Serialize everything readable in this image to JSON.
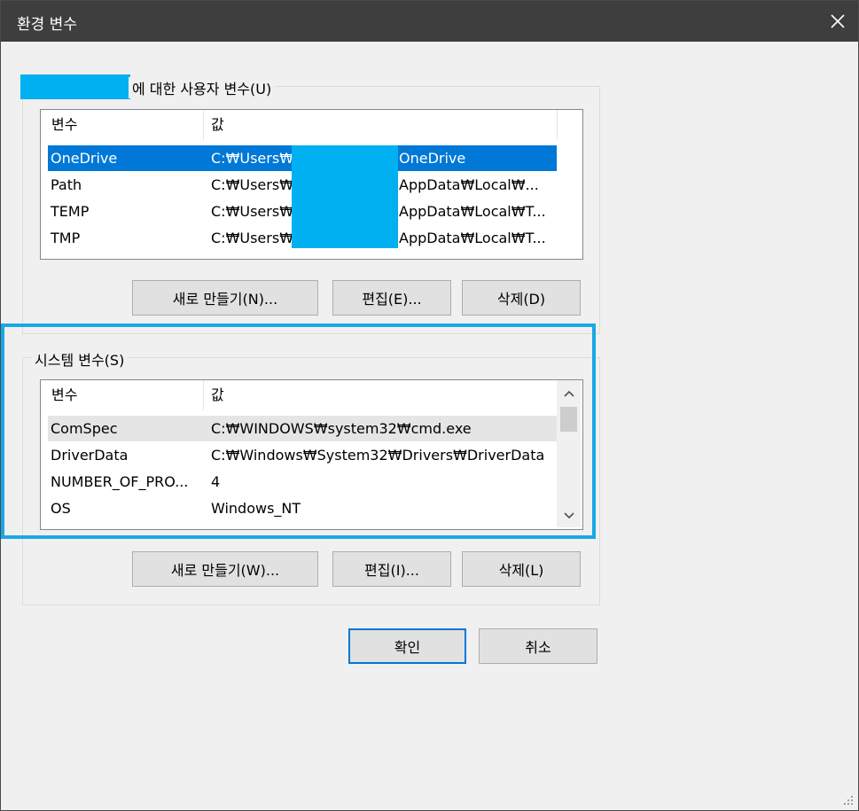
{
  "window": {
    "title": "환경 변수"
  },
  "user_vars": {
    "group_label": "에 대한 사용자 변수(U)",
    "columns": [
      "변수",
      "값"
    ],
    "rows": [
      {
        "name": "OneDrive",
        "value_prefix": "C:₩Users₩",
        "value_suffix": "OneDrive"
      },
      {
        "name": "Path",
        "value_prefix": "C:₩Users₩",
        "value_suffix": "AppData₩Local₩..."
      },
      {
        "name": "TEMP",
        "value_prefix": "C:₩Users₩",
        "value_suffix": "AppData₩Local₩T..."
      },
      {
        "name": "TMP",
        "value_prefix": "C:₩Users₩",
        "value_suffix": "AppData₩Local₩T..."
      }
    ],
    "buttons": {
      "new": "새로 만들기(N)...",
      "edit": "편집(E)...",
      "delete": "삭제(D)"
    }
  },
  "system_vars": {
    "group_label": "시스템 변수(S)",
    "columns": [
      "변수",
      "값"
    ],
    "rows": [
      {
        "name": "ComSpec",
        "value": "C:₩WINDOWS₩system32₩cmd.exe"
      },
      {
        "name": "DriverData",
        "value": "C:₩Windows₩System32₩Drivers₩DriverData"
      },
      {
        "name": "NUMBER_OF_PRO...",
        "value": "4"
      },
      {
        "name": "OS",
        "value": "Windows_NT"
      }
    ],
    "buttons": {
      "new": "새로 만들기(W)...",
      "edit": "편집(I)...",
      "delete": "삭제(L)"
    }
  },
  "footer": {
    "ok": "확인",
    "cancel": "취소"
  },
  "colors": {
    "selection": "#0078d7",
    "redaction": "#00b0f0",
    "highlight": "#1aa7e6",
    "titlebar": "#3e3e3e"
  },
  "icons": {
    "close": "close-icon",
    "scroll_up": "chevron-up-icon",
    "scroll_down": "chevron-down-icon",
    "grip": "resize-grip-icon"
  }
}
